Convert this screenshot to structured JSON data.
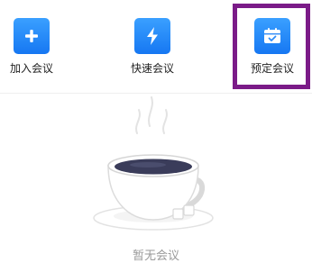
{
  "actions": [
    {
      "label": "加入会议",
      "icon": "plus-icon"
    },
    {
      "label": "快速会议",
      "icon": "lightning-icon"
    },
    {
      "label": "预定会议",
      "icon": "calendar-check-icon"
    }
  ],
  "empty_state": {
    "text": "暂无会议",
    "illustration": "coffee-cup-illustration"
  },
  "colors": {
    "accent": "#1677f2",
    "highlight_border": "#7b1b88",
    "muted_text": "#9a9a9a"
  }
}
